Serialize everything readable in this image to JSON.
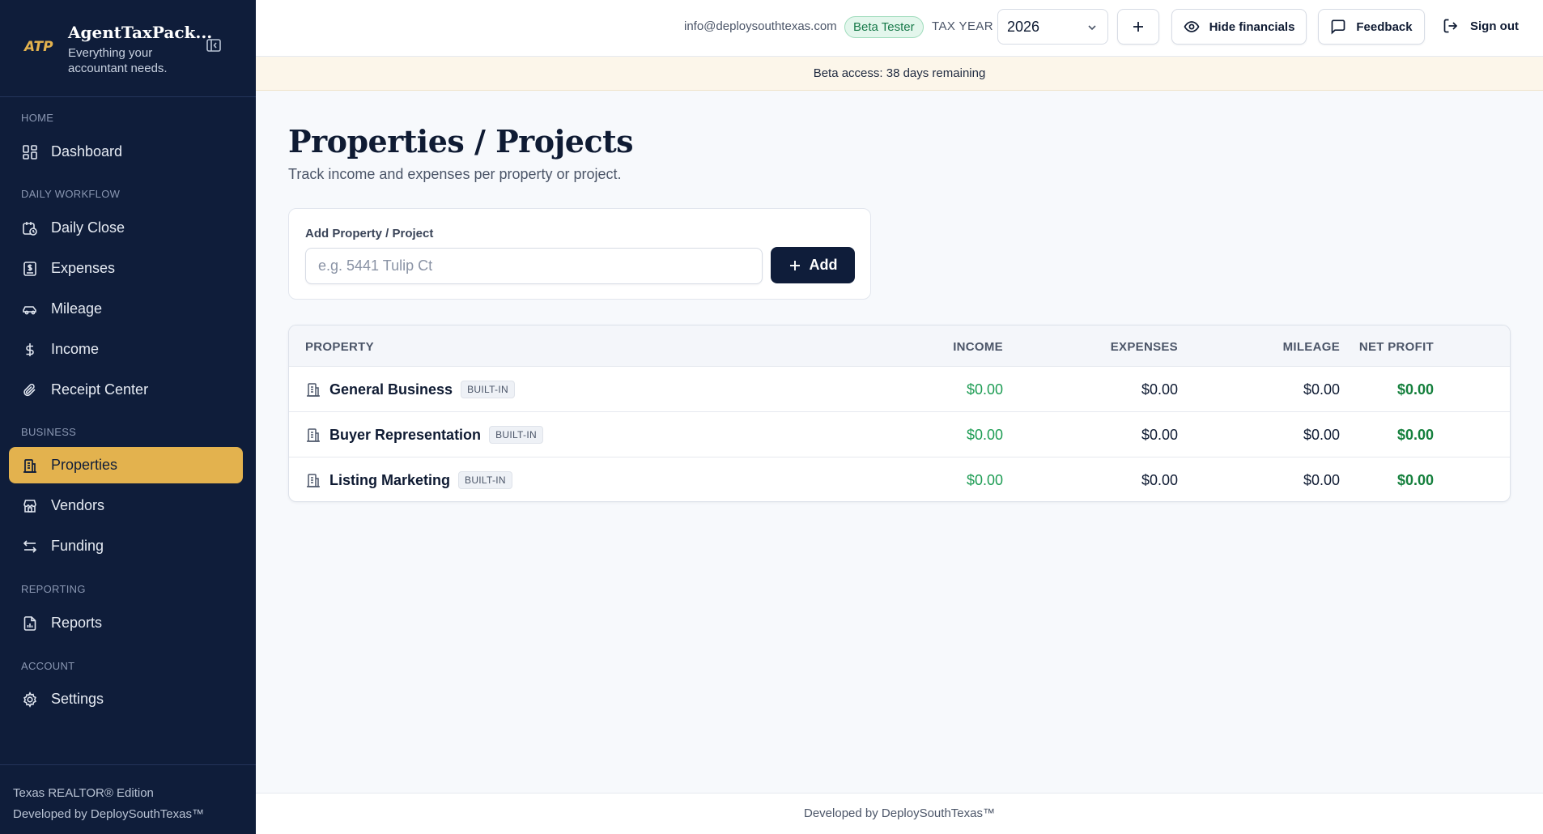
{
  "brand": {
    "logo_text": "ATP",
    "name": "AgentTaxPack...",
    "tagline": "Everything your accountant needs."
  },
  "nav": {
    "sections": {
      "home": "HOME",
      "daily": "DAILY WORKFLOW",
      "business": "BUSINESS",
      "reporting": "REPORTING",
      "account": "ACCOUNT"
    },
    "items": {
      "dashboard": "Dashboard",
      "daily_close": "Daily Close",
      "expenses": "Expenses",
      "mileage": "Mileage",
      "income": "Income",
      "receipt_center": "Receipt Center",
      "properties": "Properties",
      "vendors": "Vendors",
      "funding": "Funding",
      "reports": "Reports",
      "settings": "Settings"
    },
    "active": "properties"
  },
  "sidebar_footer": {
    "edition": "Texas REALTOR® Edition",
    "developer": "Developed by DeploySouthTexas™"
  },
  "topbar": {
    "email": "info@deploysouthtexas.com",
    "badge": "Beta Tester",
    "tax_year_label": "TAX YEAR",
    "tax_year_value": "2026",
    "hide_financials": "Hide financials",
    "feedback": "Feedback",
    "sign_out": "Sign out"
  },
  "banner": "Beta access: 38 days remaining",
  "page": {
    "title": "Properties / Projects",
    "subtitle": "Track income and expenses per property or project."
  },
  "add_form": {
    "label": "Add Property / Project",
    "placeholder": "e.g. 5441 Tulip Ct",
    "button": "Add"
  },
  "table": {
    "headers": {
      "property": "PROPERTY",
      "income": "INCOME",
      "expenses": "EXPENSES",
      "mileage": "MILEAGE",
      "net_profit": "NET PROFIT"
    },
    "rows": [
      {
        "name": "General Business",
        "tag": "BUILT-IN",
        "income": "$0.00",
        "expenses": "$0.00",
        "mileage": "$0.00",
        "net_profit": "$0.00"
      },
      {
        "name": "Buyer Representation",
        "tag": "BUILT-IN",
        "income": "$0.00",
        "expenses": "$0.00",
        "mileage": "$0.00",
        "net_profit": "$0.00"
      },
      {
        "name": "Listing Marketing",
        "tag": "BUILT-IN",
        "income": "$0.00",
        "expenses": "$0.00",
        "mileage": "$0.00",
        "net_profit": "$0.00"
      }
    ]
  },
  "footer": "Developed by DeploySouthTexas™",
  "colors": {
    "sidebar_bg": "#0f1d3a",
    "accent_gold": "#e3b24e",
    "income_green": "#1f9d55",
    "profit_green": "#15803d"
  }
}
